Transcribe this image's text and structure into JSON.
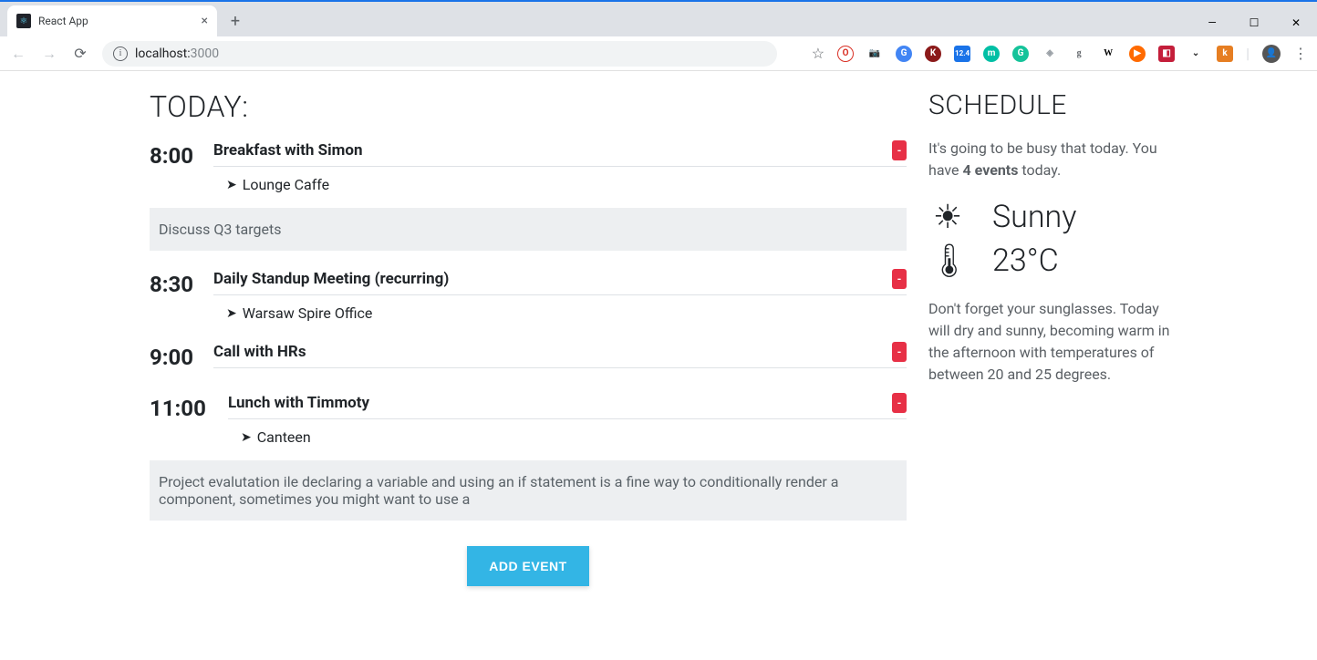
{
  "browser": {
    "tab_title": "React App",
    "url_host": "localhost:",
    "url_port": "3000"
  },
  "page": {
    "today_heading": "TODAY:",
    "schedule_heading": "SCHEDULE",
    "events": [
      {
        "time": "8:00",
        "title": "Breakfast with Simon",
        "location": "Lounge Caffe",
        "description": "Discuss Q3 targets"
      },
      {
        "time": "8:30",
        "title": "Daily Standup Meeting (recurring)",
        "location": "Warsaw Spire Office",
        "description": null
      },
      {
        "time": "9:00",
        "title": "Call with HRs",
        "location": null,
        "description": null
      },
      {
        "time": "11:00",
        "title": "Lunch with Timmoty",
        "location": "Canteen",
        "description": "Project evalutation ile declaring a variable and using an if statement is a fine way to conditionally render a component, sometimes you might want to use a"
      }
    ],
    "add_event_label": "ADD EVENT",
    "remove_label": "-",
    "schedule_intro_pre": "It's going to be busy that today. You have ",
    "schedule_intro_bold": "4 events",
    "schedule_intro_post": " today.",
    "weather_condition": "Sunny",
    "weather_temp": "23°C",
    "weather_note": "Don't forget your sunglasses. Today will dry and sunny, becoming warm in the afternoon with temperatures of between 20 and 25 degrees."
  }
}
